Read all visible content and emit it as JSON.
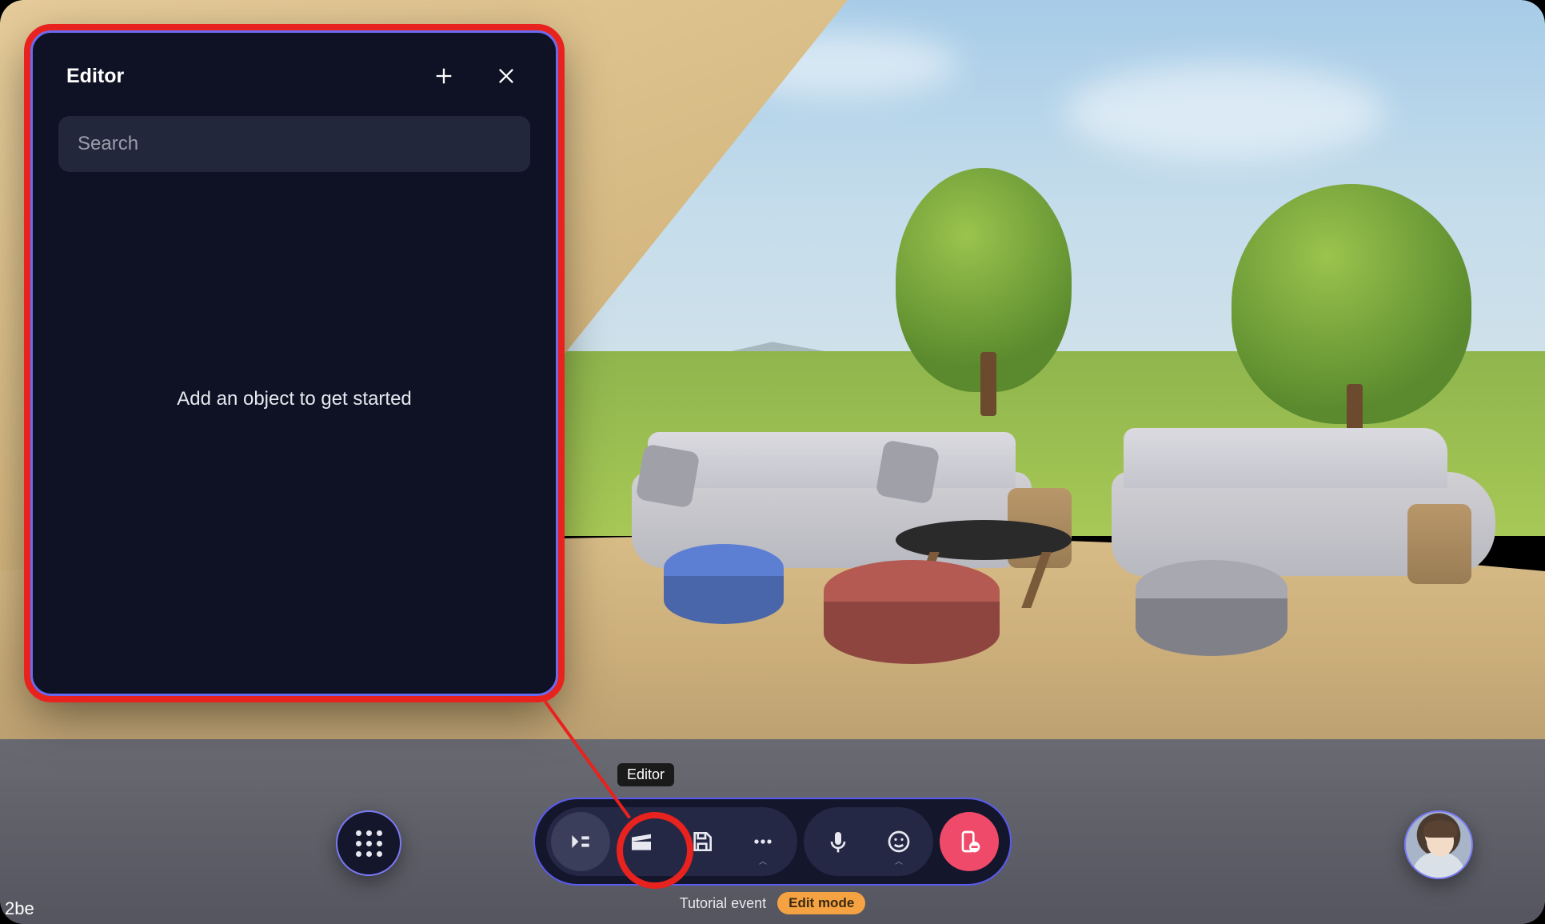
{
  "editor": {
    "title": "Editor",
    "search_placeholder": "Search",
    "empty_message": "Add an object to get started"
  },
  "toolbar": {
    "tooltip_editor": "Editor",
    "buttons": {
      "editor": "editor",
      "scenes": "scenes",
      "save": "save",
      "more": "more",
      "mic": "microphone",
      "reactions": "reactions",
      "exit": "exit-edit"
    }
  },
  "footer": {
    "event_label": "Tutorial event",
    "mode_badge": "Edit mode"
  },
  "corner": "2be"
}
